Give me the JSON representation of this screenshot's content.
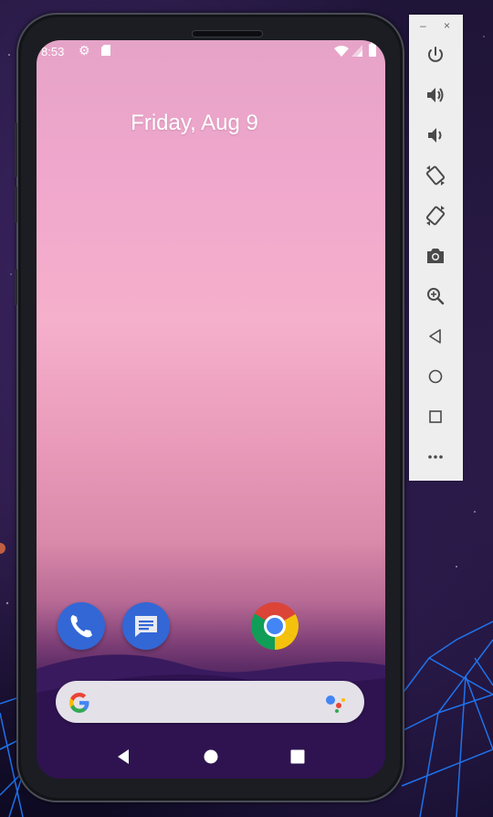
{
  "status_bar": {
    "time": "8:53",
    "icons": [
      "gear-icon",
      "sd-card-icon",
      "wifi-icon",
      "signal-icon",
      "battery-icon"
    ]
  },
  "home_screen": {
    "date": "Friday, Aug 9",
    "dock_apps": [
      {
        "name": "Phone",
        "icon": "phone-icon"
      },
      {
        "name": "Messages",
        "icon": "messages-icon"
      },
      {
        "name": "Chrome",
        "icon": "chrome-icon"
      }
    ],
    "search_bar": {
      "icon_left": "google-g-icon",
      "icon_right": "google-assistant-icon"
    }
  },
  "nav_bar": {
    "buttons": [
      "back-icon",
      "home-icon",
      "recents-icon"
    ]
  },
  "emulator_toolbar": {
    "window_controls": {
      "minimize": "–",
      "close": "×"
    },
    "buttons": [
      "power",
      "volume-up",
      "volume-down",
      "rotate-left",
      "rotate-right",
      "screenshot",
      "zoom",
      "back",
      "home",
      "overview",
      "more"
    ],
    "more_label": "•••"
  },
  "colors": {
    "brand_blue": "#3367d6",
    "toolbar_icon": "#4a4a4a",
    "wallpaper_pink": "#f5b0cb",
    "wallpaper_purple": "#2a1145"
  }
}
